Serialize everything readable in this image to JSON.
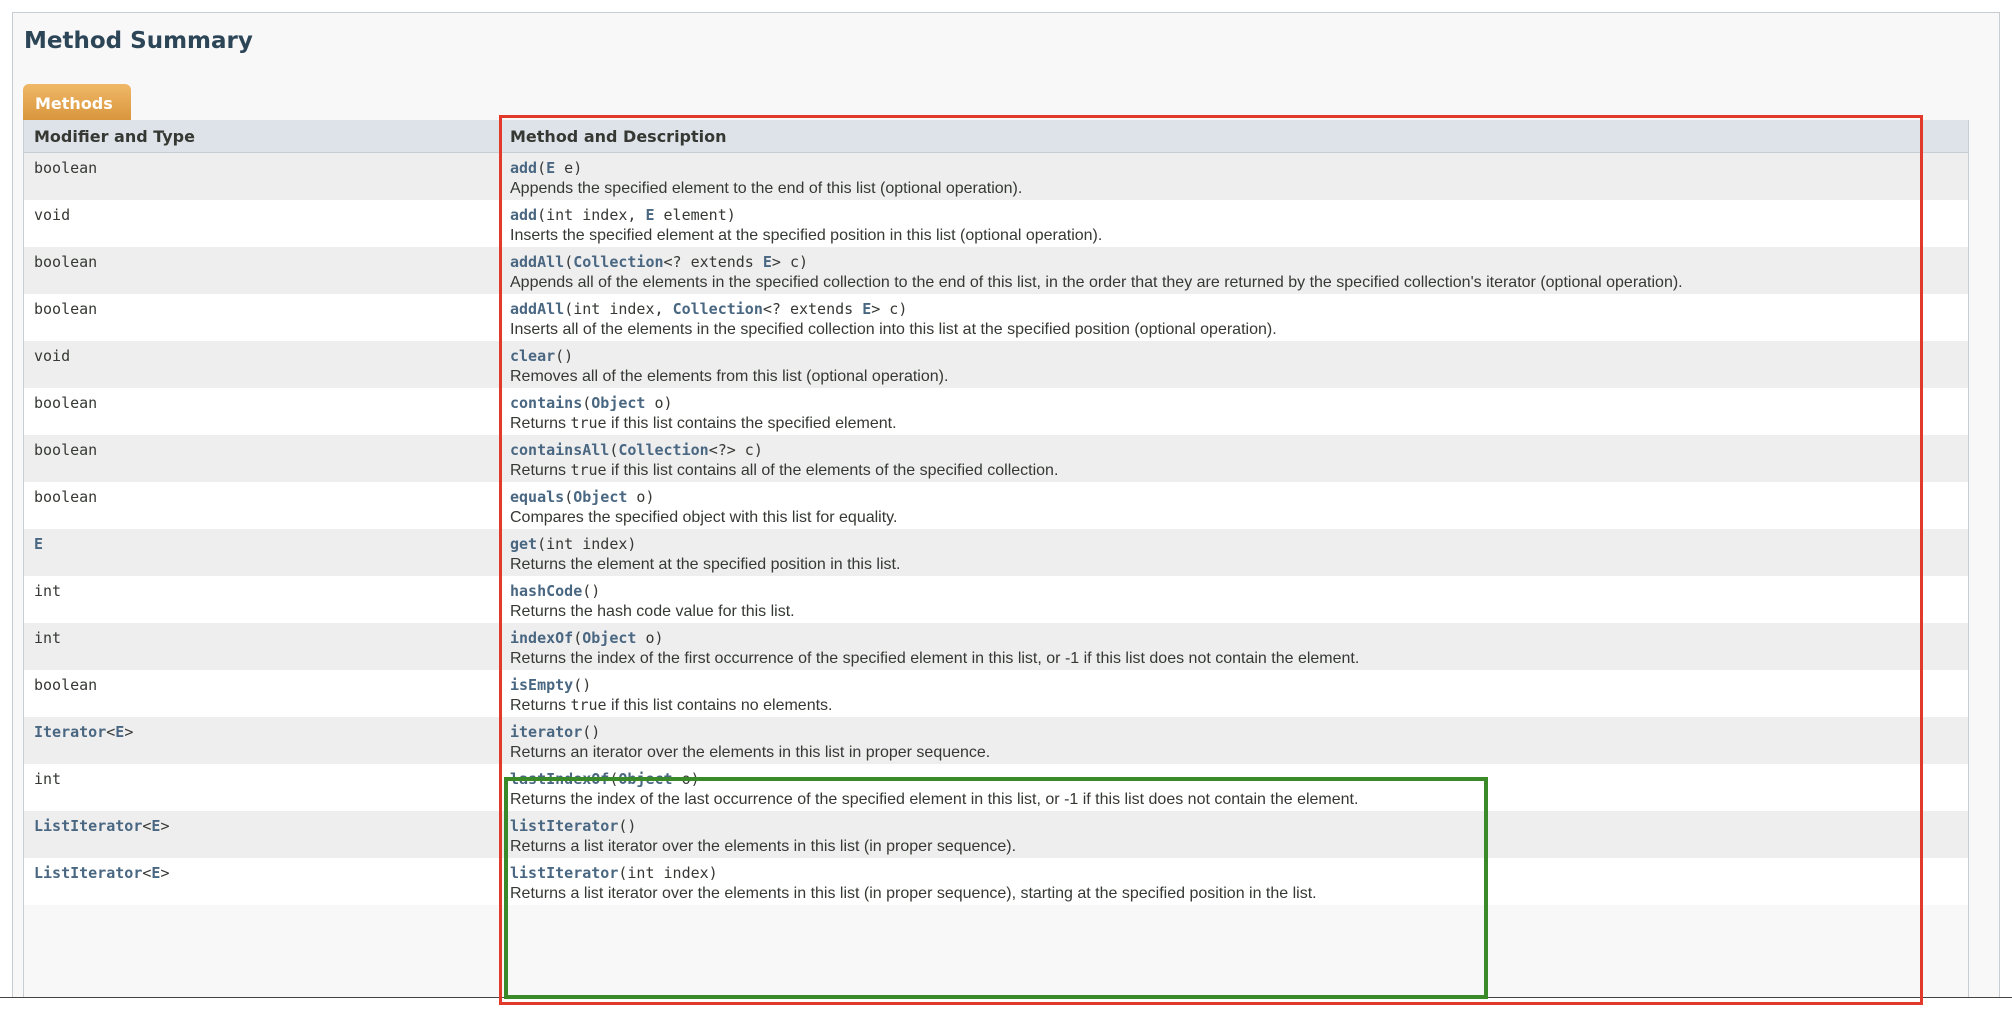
{
  "section": {
    "title": "Method Summary",
    "tab_label": "Methods"
  },
  "table": {
    "headers": [
      "Modifier and Type",
      "Method and Description"
    ],
    "rows": [
      {
        "type": [
          {
            "t": "boolean"
          }
        ],
        "sig": [
          {
            "t": "add",
            "link": true
          },
          {
            "t": "("
          },
          {
            "t": "E",
            "link": true
          },
          {
            "t": " e)"
          }
        ],
        "desc": [
          {
            "t": "Appends the specified element to the end of this list (optional operation)."
          }
        ]
      },
      {
        "type": [
          {
            "t": "void"
          }
        ],
        "sig": [
          {
            "t": "add",
            "link": true
          },
          {
            "t": "(int index, "
          },
          {
            "t": "E",
            "link": true
          },
          {
            "t": " element)"
          }
        ],
        "desc": [
          {
            "t": "Inserts the specified element at the specified position in this list (optional operation)."
          }
        ]
      },
      {
        "type": [
          {
            "t": "boolean"
          }
        ],
        "sig": [
          {
            "t": "addAll",
            "link": true
          },
          {
            "t": "("
          },
          {
            "t": "Collection",
            "link": true
          },
          {
            "t": "<? extends "
          },
          {
            "t": "E",
            "link": true
          },
          {
            "t": "> c)"
          }
        ],
        "desc": [
          {
            "t": "Appends all of the elements in the specified collection to the end of this list, in the order that they are returned by the specified collection's iterator (optional operation)."
          }
        ]
      },
      {
        "type": [
          {
            "t": "boolean"
          }
        ],
        "sig": [
          {
            "t": "addAll",
            "link": true
          },
          {
            "t": "(int index, "
          },
          {
            "t": "Collection",
            "link": true
          },
          {
            "t": "<? extends "
          },
          {
            "t": "E",
            "link": true
          },
          {
            "t": "> c)"
          }
        ],
        "desc": [
          {
            "t": "Inserts all of the elements in the specified collection into this list at the specified position (optional operation)."
          }
        ]
      },
      {
        "type": [
          {
            "t": "void"
          }
        ],
        "sig": [
          {
            "t": "clear",
            "link": true
          },
          {
            "t": "()"
          }
        ],
        "desc": [
          {
            "t": "Removes all of the elements from this list (optional operation)."
          }
        ]
      },
      {
        "type": [
          {
            "t": "boolean"
          }
        ],
        "sig": [
          {
            "t": "contains",
            "link": true
          },
          {
            "t": "("
          },
          {
            "t": "Object",
            "link": true
          },
          {
            "t": " o)"
          }
        ],
        "desc": [
          {
            "t": "Returns "
          },
          {
            "t": "true",
            "code": true
          },
          {
            "t": " if this list contains the specified element."
          }
        ]
      },
      {
        "type": [
          {
            "t": "boolean"
          }
        ],
        "sig": [
          {
            "t": "containsAll",
            "link": true
          },
          {
            "t": "("
          },
          {
            "t": "Collection",
            "link": true
          },
          {
            "t": "<?> c)"
          }
        ],
        "desc": [
          {
            "t": "Returns "
          },
          {
            "t": "true",
            "code": true
          },
          {
            "t": " if this list contains all of the elements of the specified collection."
          }
        ]
      },
      {
        "type": [
          {
            "t": "boolean"
          }
        ],
        "sig": [
          {
            "t": "equals",
            "link": true
          },
          {
            "t": "("
          },
          {
            "t": "Object",
            "link": true
          },
          {
            "t": " o)"
          }
        ],
        "desc": [
          {
            "t": "Compares the specified object with this list for equality."
          }
        ]
      },
      {
        "type": [
          {
            "t": "E",
            "link": true
          }
        ],
        "sig": [
          {
            "t": "get",
            "link": true
          },
          {
            "t": "(int index)"
          }
        ],
        "desc": [
          {
            "t": "Returns the element at the specified position in this list."
          }
        ]
      },
      {
        "type": [
          {
            "t": "int"
          }
        ],
        "sig": [
          {
            "t": "hashCode",
            "link": true
          },
          {
            "t": "()"
          }
        ],
        "desc": [
          {
            "t": "Returns the hash code value for this list."
          }
        ]
      },
      {
        "type": [
          {
            "t": "int"
          }
        ],
        "sig": [
          {
            "t": "indexOf",
            "link": true
          },
          {
            "t": "("
          },
          {
            "t": "Object",
            "link": true
          },
          {
            "t": " o)"
          }
        ],
        "desc": [
          {
            "t": "Returns the index of the first occurrence of the specified element in this list, or -1 if this list does not contain the element."
          }
        ]
      },
      {
        "type": [
          {
            "t": "boolean"
          }
        ],
        "sig": [
          {
            "t": "isEmpty",
            "link": true
          },
          {
            "t": "()"
          }
        ],
        "desc": [
          {
            "t": "Returns "
          },
          {
            "t": "true",
            "code": true
          },
          {
            "t": " if this list contains no elements."
          }
        ]
      },
      {
        "type": [
          {
            "t": "Iterator",
            "link": true
          },
          {
            "t": "<"
          },
          {
            "t": "E",
            "link": true
          },
          {
            "t": ">"
          }
        ],
        "sig": [
          {
            "t": "iterator",
            "link": true
          },
          {
            "t": "()"
          }
        ],
        "desc": [
          {
            "t": "Returns an iterator over the elements in this list in proper sequence."
          }
        ]
      },
      {
        "type": [
          {
            "t": "int"
          }
        ],
        "sig": [
          {
            "t": "lastIndexOf",
            "link": true
          },
          {
            "t": "("
          },
          {
            "t": "Object",
            "link": true
          },
          {
            "t": " o)"
          }
        ],
        "desc": [
          {
            "t": "Returns the index of the last occurrence of the specified element in this list, or -1 if this list does not contain the element."
          }
        ]
      },
      {
        "type": [
          {
            "t": "ListIterator",
            "link": true
          },
          {
            "t": "<"
          },
          {
            "t": "E",
            "link": true
          },
          {
            "t": ">"
          }
        ],
        "sig": [
          {
            "t": "listIterator",
            "link": true
          },
          {
            "t": "()"
          }
        ],
        "desc": [
          {
            "t": "Returns a list iterator over the elements in this list (in proper sequence)."
          }
        ]
      },
      {
        "type": [
          {
            "t": "ListIterator",
            "link": true
          },
          {
            "t": "<"
          },
          {
            "t": "E",
            "link": true
          },
          {
            "t": ">"
          }
        ],
        "sig": [
          {
            "t": "listIterator",
            "link": true
          },
          {
            "t": "(int index)"
          }
        ],
        "desc": [
          {
            "t": "Returns a list iterator over the elements in this list (in proper sequence), starting at the specified position in the list."
          }
        ]
      }
    ]
  },
  "colors": {
    "link": "#4a6782",
    "tab": "#dca04c",
    "header_bg": "#dee3e9",
    "row_alt": "#eeeeef",
    "highlight_red": "#e23a2a",
    "highlight_green": "#3a8a2a"
  }
}
